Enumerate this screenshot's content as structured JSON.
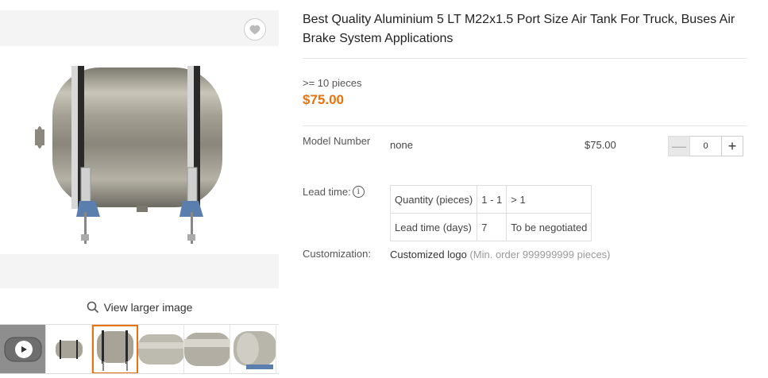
{
  "gallery": {
    "favorite_icon": "heart-icon",
    "view_larger_label": "View larger image",
    "view_larger_icon": "search-icon",
    "thumbnails": [
      {
        "kind": "video",
        "icon": "play-icon"
      },
      {
        "kind": "image"
      },
      {
        "kind": "image",
        "active": true
      },
      {
        "kind": "image"
      },
      {
        "kind": "image"
      },
      {
        "kind": "image"
      }
    ]
  },
  "product": {
    "title": "Best Quality Aluminium 5 LT M22x1.5 Port Size Air Tank For Truck, Buses Air Brake System Applications",
    "qty_range": ">= 10 pieces",
    "price": "$75.00"
  },
  "variant": {
    "label": "Model Number",
    "value": "none",
    "price": "$75.00",
    "quantity": "0",
    "minus_symbol": "—",
    "plus_symbol": "+"
  },
  "lead_time": {
    "label": "Lead time:",
    "info_icon": "info-icon",
    "info_symbol": "i",
    "rows": [
      [
        "Quantity (pieces)",
        "1 - 1",
        "> 1"
      ],
      [
        "Lead time (days)",
        "7",
        "To be negotiated"
      ]
    ]
  },
  "customization": {
    "label": "Customization:",
    "value": "Customized logo",
    "note": "(Min. order 999999999 pieces)"
  },
  "colors": {
    "accent": "#e8730e",
    "text": "#333333",
    "muted": "#999999",
    "border": "#dddddd"
  }
}
